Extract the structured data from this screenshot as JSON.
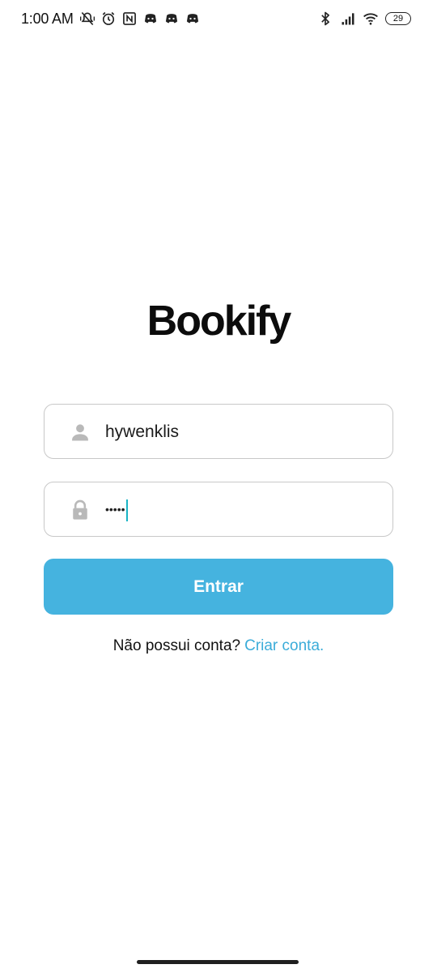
{
  "status_bar": {
    "time": "1:00 AM",
    "battery_level": "29",
    "left_icons": [
      "mute-vibrate-icon",
      "alarm-icon",
      "nfc-icon",
      "discord-icon",
      "discord-icon",
      "discord-icon"
    ],
    "right_icons": [
      "bluetooth-icon",
      "signal-icon",
      "wifi-icon",
      "battery-icon"
    ]
  },
  "app": {
    "logo_text": "Bookify"
  },
  "login_form": {
    "username_value": "hywenklis",
    "username_icon": "person-icon",
    "password_masked": "•••••",
    "password_icon": "lock-icon",
    "submit_label": "Entrar"
  },
  "signup": {
    "prompt": "Não possui conta?",
    "link_label": "Criar conta."
  },
  "colors": {
    "primary_button": "#45b3df",
    "link": "#3bacd9",
    "caret": "#18b3c4"
  }
}
